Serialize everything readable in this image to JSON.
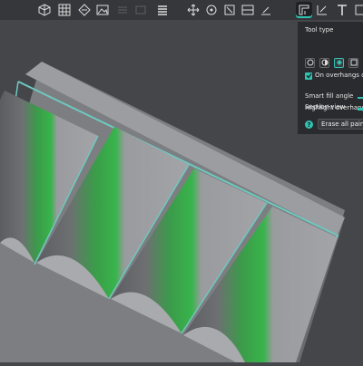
{
  "colors": {
    "background": "#45464a",
    "toolbar": "#36373b",
    "panel": "#2a2b2e",
    "accent": "#2fc4b2",
    "paint_green": "#37b449",
    "model_gray": "#8c8d90"
  },
  "toolbar": {
    "icons": [
      "cube-icon",
      "grid-icon",
      "arrange-icon",
      "image-icon",
      "slice-plate-icon",
      "layers-icon",
      "move-icon",
      "rotate-icon",
      "scale-icon",
      "cut-icon",
      "support-paint-icon",
      "seam-paint-icon",
      "text-icon",
      "mesh-icon"
    ]
  },
  "panel": {
    "tool_type_label": "Tool type",
    "tool_types": [
      "circle-brush-icon",
      "sphere-brush-icon",
      "fill-icon",
      "gap-fill-icon"
    ],
    "on_overhangs_only_label": "On overhangs only",
    "on_overhangs_only_checked": true,
    "smart_fill_angle_label": "Smart fill angle",
    "highlight_overhangs_label": "Highlight overhangs",
    "section_view_label": "Section view",
    "help_glyph": "?",
    "erase_all_label": "Erase all painting"
  }
}
